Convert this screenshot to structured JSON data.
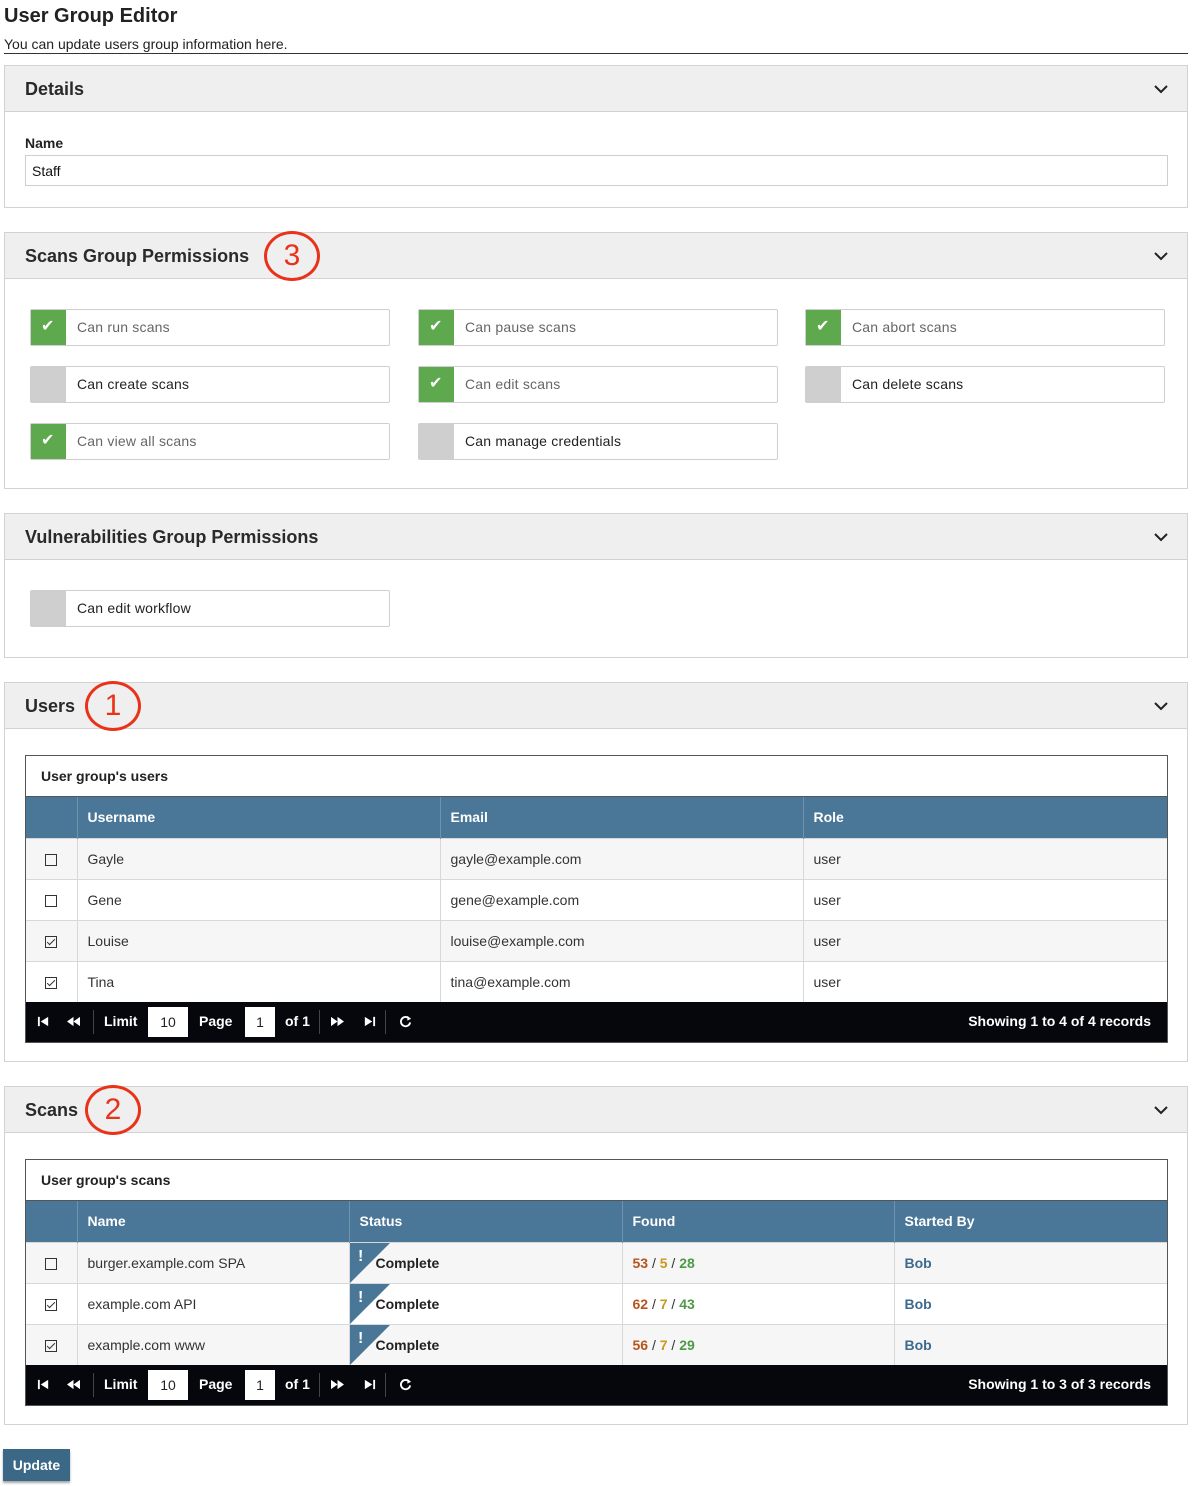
{
  "header": {
    "title": "User Group Editor",
    "subtitle": "You can update users group information here."
  },
  "details": {
    "title": "Details",
    "name_label": "Name",
    "name_value": "Staff"
  },
  "scans_permissions": {
    "title": "Scans Group Permissions",
    "callout": "3",
    "items": [
      {
        "label": "Can run scans",
        "checked": true
      },
      {
        "label": "Can pause scans",
        "checked": true
      },
      {
        "label": "Can abort scans",
        "checked": true
      },
      {
        "label": "Can create scans",
        "checked": false
      },
      {
        "label": "Can edit scans",
        "checked": true
      },
      {
        "label": "Can delete scans",
        "checked": false
      },
      {
        "label": "Can view all scans",
        "checked": true
      },
      {
        "label": "Can manage credentials",
        "checked": false
      }
    ]
  },
  "vuln_permissions": {
    "title": "Vulnerabilities Group Permissions",
    "items": [
      {
        "label": "Can edit workflow",
        "checked": false
      }
    ]
  },
  "users": {
    "title": "Users",
    "callout": "1",
    "caption": "User group's users",
    "columns": [
      "Username",
      "Email",
      "Role"
    ],
    "rows": [
      {
        "checked": false,
        "username": "Gayle",
        "email": "gayle@example.com",
        "role": "user"
      },
      {
        "checked": false,
        "username": "Gene",
        "email": "gene@example.com",
        "role": "user"
      },
      {
        "checked": true,
        "username": "Louise",
        "email": "louise@example.com",
        "role": "user"
      },
      {
        "checked": true,
        "username": "Tina",
        "email": "tina@example.com",
        "role": "user"
      }
    ],
    "pager": {
      "limit_label": "Limit",
      "limit": "10",
      "page_label": "Page",
      "page": "1",
      "of": "of 1",
      "summary": "Showing 1 to 4 of 4 records"
    }
  },
  "scans": {
    "title": "Scans",
    "callout": "2",
    "caption": "User group's scans",
    "columns": [
      "Name",
      "Status",
      "Found",
      "Started By"
    ],
    "rows": [
      {
        "checked": false,
        "name": "burger.example.com SPA",
        "status": "Complete",
        "found": [
          "53",
          "5",
          "28"
        ],
        "started_by": "Bob"
      },
      {
        "checked": true,
        "name": "example.com API",
        "status": "Complete",
        "found": [
          "62",
          "7",
          "43"
        ],
        "started_by": "Bob"
      },
      {
        "checked": true,
        "name": "example.com www",
        "status": "Complete",
        "found": [
          "56",
          "7",
          "29"
        ],
        "started_by": "Bob"
      }
    ],
    "pager": {
      "limit_label": "Limit",
      "limit": "10",
      "page_label": "Page",
      "page": "1",
      "of": "of 1",
      "summary": "Showing 1 to 3 of 3 records"
    }
  },
  "actions": {
    "update_label": "Update"
  },
  "colors": {
    "accent": "#4a7698",
    "toggle_on": "#5ea84e",
    "callout": "#e8331a",
    "button": "#3a6886"
  }
}
